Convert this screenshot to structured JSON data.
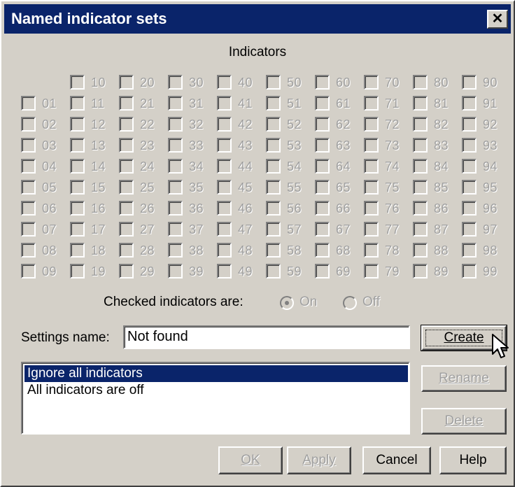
{
  "dialog": {
    "title": "Named indicator sets",
    "close_icon": "close-icon"
  },
  "indicators": {
    "section_label": "Indicators",
    "header_row": [
      "10",
      "20",
      "30",
      "40",
      "50",
      "60",
      "70",
      "80",
      "90"
    ],
    "rows": [
      [
        "01",
        "11",
        "21",
        "31",
        "41",
        "51",
        "61",
        "71",
        "81",
        "91"
      ],
      [
        "02",
        "12",
        "22",
        "32",
        "42",
        "52",
        "62",
        "72",
        "82",
        "92"
      ],
      [
        "03",
        "13",
        "23",
        "33",
        "43",
        "53",
        "63",
        "73",
        "83",
        "93"
      ],
      [
        "04",
        "14",
        "24",
        "34",
        "44",
        "54",
        "64",
        "74",
        "84",
        "94"
      ],
      [
        "05",
        "15",
        "25",
        "35",
        "45",
        "55",
        "65",
        "75",
        "85",
        "95"
      ],
      [
        "06",
        "16",
        "26",
        "36",
        "46",
        "56",
        "66",
        "76",
        "86",
        "96"
      ],
      [
        "07",
        "17",
        "27",
        "37",
        "47",
        "57",
        "67",
        "77",
        "87",
        "97"
      ],
      [
        "08",
        "18",
        "28",
        "38",
        "48",
        "58",
        "68",
        "78",
        "88",
        "98"
      ],
      [
        "09",
        "19",
        "29",
        "39",
        "49",
        "59",
        "69",
        "79",
        "89",
        "99"
      ]
    ],
    "checked_label": "Checked indicators are:",
    "radio_on": "On",
    "radio_off": "Off",
    "selected_state": "On"
  },
  "settings": {
    "name_label": "Settings name:",
    "name_value": "Not found"
  },
  "list": {
    "items": [
      "Ignore all indicators",
      "All indicators are off"
    ],
    "selected_index": 0
  },
  "buttons": {
    "create": "Create",
    "rename": "Rename",
    "delete": "Delete",
    "ok": "OK",
    "apply": "Apply",
    "cancel": "Cancel",
    "help": "Help"
  },
  "colors": {
    "face": "#d4d0c8",
    "title_bar": "#0a246a",
    "selection": "#0a246a",
    "disabled_text": "#a0a0a0"
  }
}
